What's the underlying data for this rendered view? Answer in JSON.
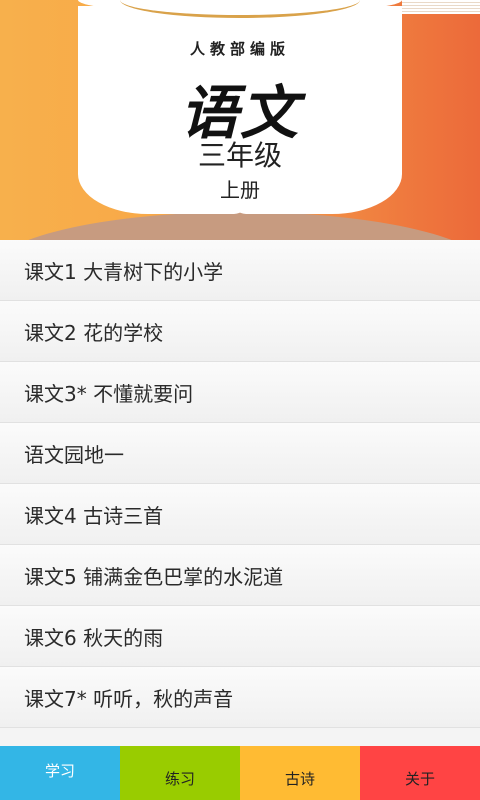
{
  "header": {
    "publisher": "人教部编版",
    "subject": "语文",
    "grade": "三年级",
    "volume": "上册"
  },
  "lessons": [
    {
      "label": "课文1 大青树下的小学"
    },
    {
      "label": "课文2 花的学校"
    },
    {
      "label": "课文3* 不懂就要问"
    },
    {
      "label": "语文园地一"
    },
    {
      "label": "课文4 古诗三首"
    },
    {
      "label": "课文5 铺满金色巴掌的水泥道"
    },
    {
      "label": "课文6 秋天的雨"
    },
    {
      "label": "课文7* 听听，秋的声音"
    }
  ],
  "tabs": {
    "study": "学习",
    "practice": "练习",
    "poetry": "古诗",
    "about": "关于"
  },
  "colors": {
    "tab_study": "#33b6e6",
    "tab_practice": "#99cc00",
    "tab_poetry": "#ffbb33",
    "tab_about": "#ff4444"
  }
}
